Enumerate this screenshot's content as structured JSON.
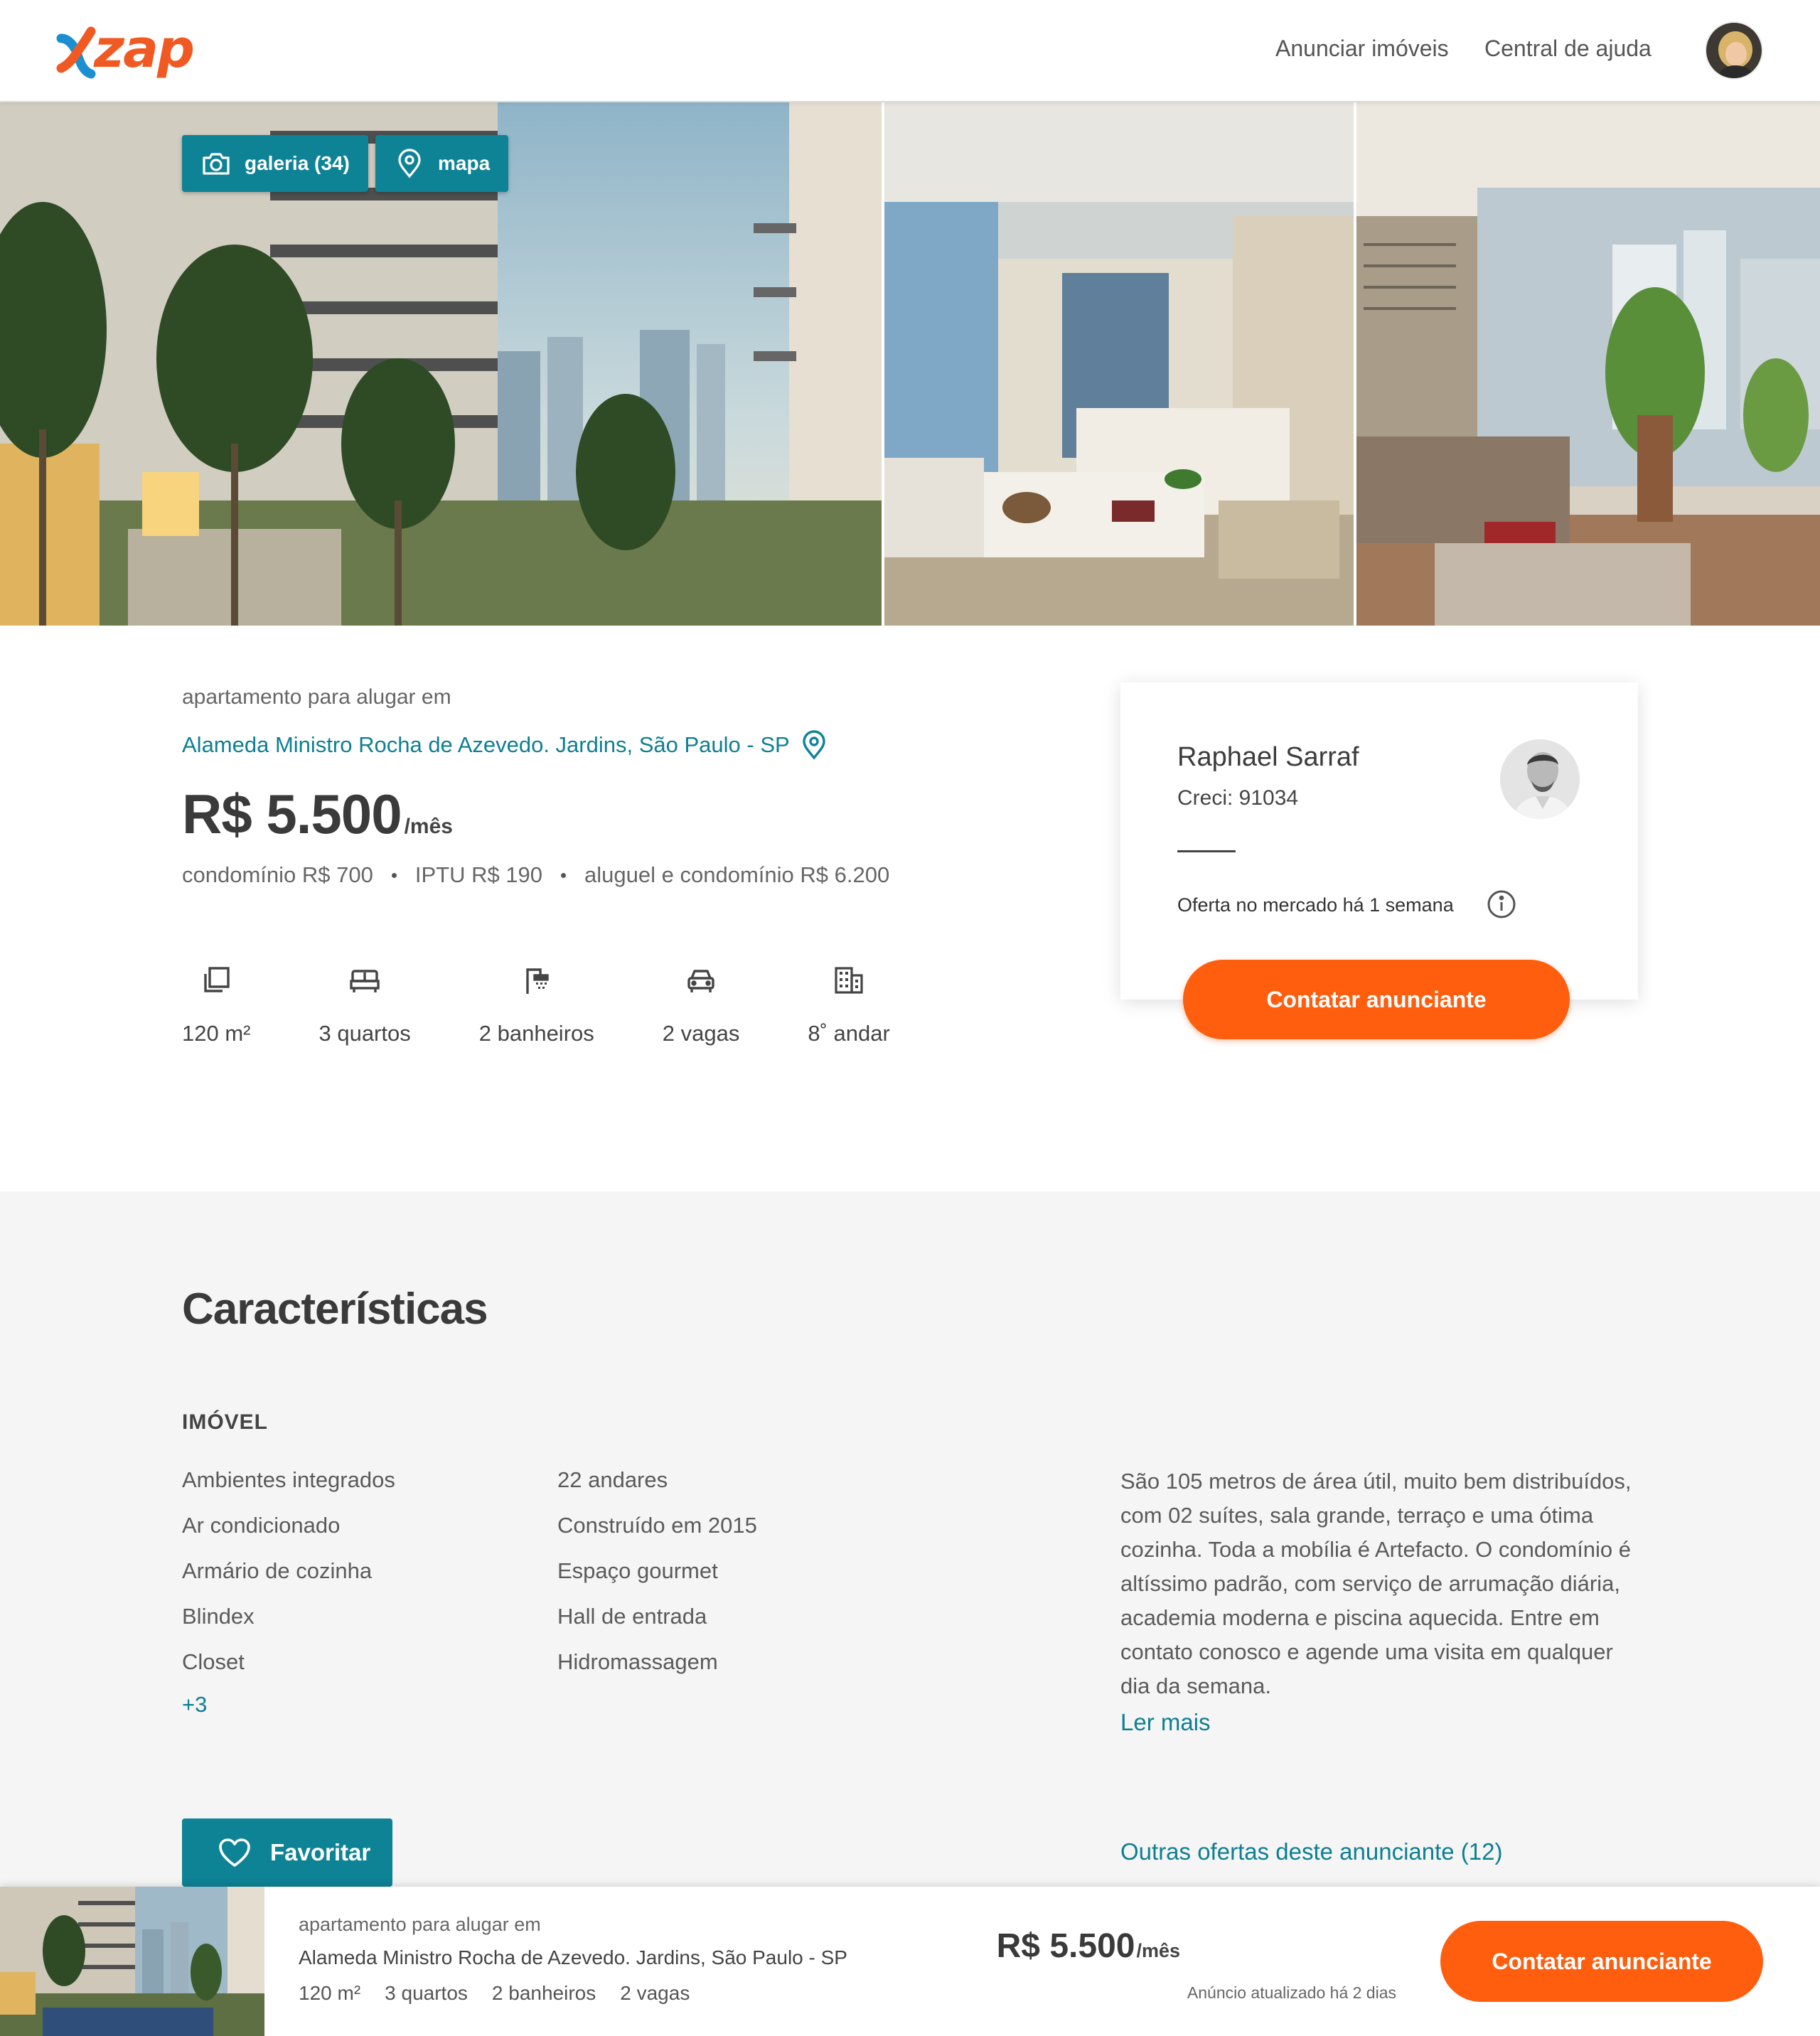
{
  "header": {
    "logo_text": "zap",
    "nav": {
      "anunciar": "Anunciar imóveis",
      "ajuda": "Central de ajuda"
    }
  },
  "gallery": {
    "galeria_label": "galeria (34)",
    "mapa_label": "mapa"
  },
  "listing": {
    "subtitle": "apartamento para alugar em",
    "address": "Alameda Ministro Rocha de Azevedo. Jardins, São Paulo - SP",
    "price": "R$ 5.500",
    "price_unit": "/mês",
    "fees": {
      "condominio": "condomínio R$ 700",
      "iptu": "IPTU R$ 190",
      "total": "aluguel e condomínio R$ 6.200"
    },
    "amenities": [
      {
        "icon": "area-icon",
        "label": "120 m²"
      },
      {
        "icon": "bed-icon",
        "label": "3 quartos"
      },
      {
        "icon": "shower-icon",
        "label": "2 banheiros"
      },
      {
        "icon": "car-icon",
        "label": "2 vagas"
      },
      {
        "icon": "building-icon",
        "label": "8˚ andar"
      }
    ]
  },
  "agent": {
    "name": "Raphael Sarraf",
    "creci": "Creci: 91034",
    "offer_time": "Oferta no mercado há 1 semana",
    "contact_label": "Contatar anunciante"
  },
  "features": {
    "title": "Características",
    "subtitle": "IMÓVEL",
    "col1": [
      "Ambientes integrados",
      "Ar condicionado",
      "Armário de cozinha",
      "Blindex",
      "Closet"
    ],
    "col2": [
      "22 andares",
      "Construído em 2015",
      "Espaço gourmet",
      "Hall de entrada",
      "Hidromassagem"
    ],
    "more": "+3",
    "description": "São 105 metros de área útil, muito bem distribuídos, com 02 suítes, sala grande, terraço e uma ótima cozinha. Toda a mobília é Artefacto. O condomínio é altíssimo padrão, com serviço de arrumação diária, academia moderna e piscina aquecida. Entre em contato conosco e agende uma visita em qualquer dia da semana.",
    "read_more": "Ler mais",
    "favorite_label": "Favoritar",
    "other_offers": "Outras ofertas deste anunciante (12)"
  },
  "sticky": {
    "subtitle": "apartamento para alugar em",
    "address": "Alameda Ministro Rocha de Azevedo. Jardins, São Paulo - SP",
    "specs": [
      "120 m²",
      "3 quartos",
      "2 banheiros",
      "2 vagas"
    ],
    "price": "R$ 5.500",
    "price_unit": "/mês",
    "updated": "Anúncio atualizado há 2 dias",
    "contact_label": "Contatar anunciante"
  },
  "colors": {
    "brand_orange": "#ff5e0e",
    "brand_teal": "#0e8396",
    "link_teal": "#0e7f91",
    "section_bg": "#f5f5f5"
  }
}
